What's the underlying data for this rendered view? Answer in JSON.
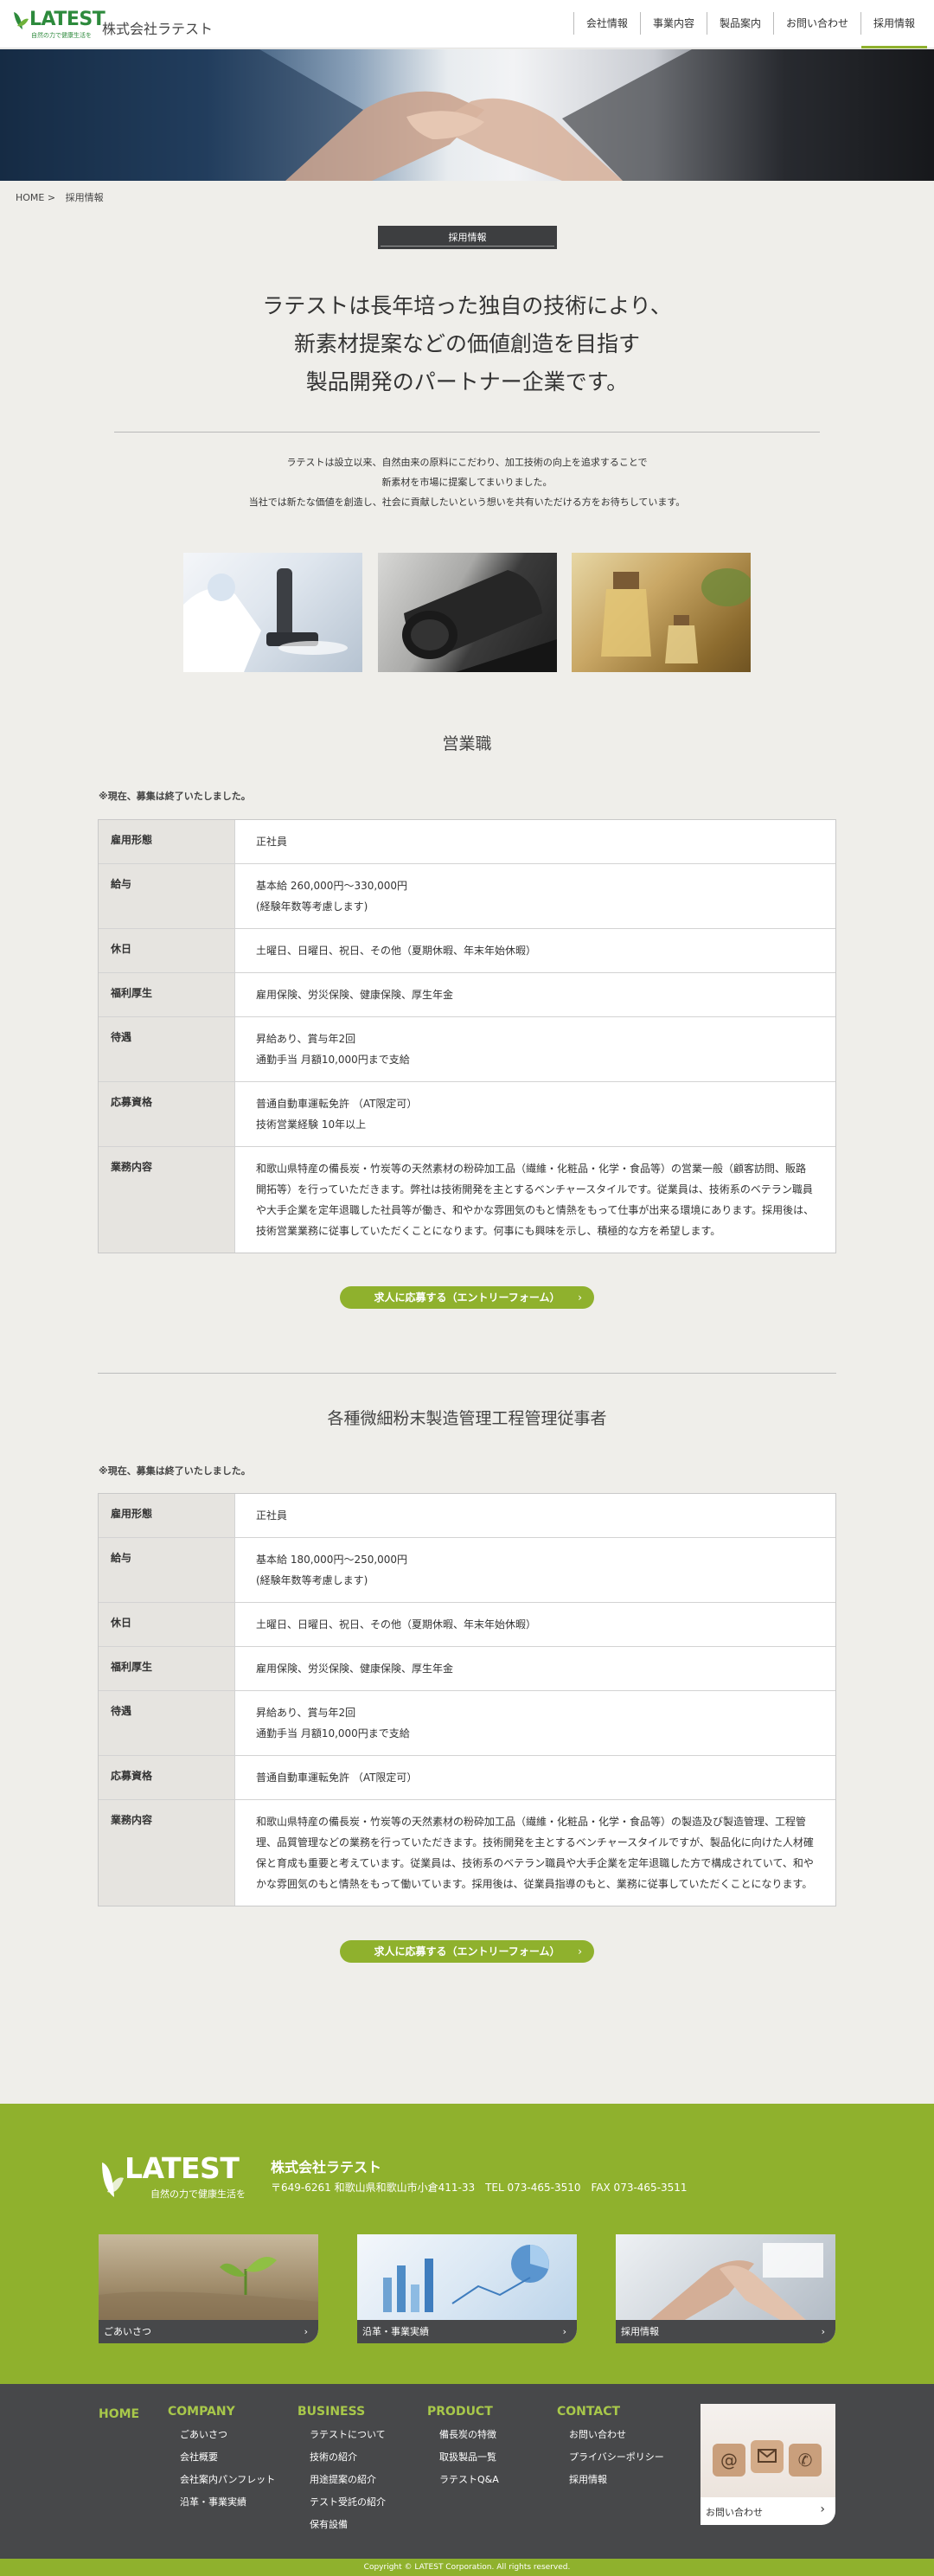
{
  "header": {
    "logo_word": "LATEST",
    "logo_tagline": "自然の力で健康生活を",
    "company_name": "株式会社ラテスト",
    "nav": [
      "会社情報",
      "事業内容",
      "製品案内",
      "お問い合わせ",
      "採用情報"
    ]
  },
  "breadcrumb": {
    "home": "HOME",
    "sep": ">",
    "current": "採用情報"
  },
  "page_title": "採用情報",
  "catch": [
    "ラテストは長年培った独自の技術により、",
    "新素材提案などの価値創造を目指す",
    "製品開発のパートナー企業です。"
  ],
  "intro": [
    "ラテストは設立以来、自然由来の原料にこだわり、加工技術の向上を追求することで",
    "新素材を市場に提案してまいりました。",
    "当社では新たな価値を創造し、社会に貢献したいという想いを共有いただける方をお待ちしています。"
  ],
  "jobs": [
    {
      "title": "営業職",
      "notice": "※現在、募集は終了いたしました。",
      "rows": [
        {
          "label": "雇用形態",
          "lines": [
            "正社員"
          ]
        },
        {
          "label": "給与",
          "lines": [
            "基本給 260,000円〜330,000円",
            "(経験年数等考慮します)"
          ]
        },
        {
          "label": "休日",
          "lines": [
            "土曜日、日曜日、祝日、その他（夏期休暇、年末年始休暇）"
          ]
        },
        {
          "label": "福利厚生",
          "lines": [
            "雇用保険、労災保険、健康保険、厚生年金"
          ]
        },
        {
          "label": "待遇",
          "lines": [
            "昇給あり、賞与年2回",
            "通勤手当 月額10,000円まで支給"
          ]
        },
        {
          "label": "応募資格",
          "lines": [
            "普通自動車運転免許 （AT限定可）",
            "技術営業経験 10年以上"
          ]
        },
        {
          "label": "業務内容",
          "lines": [
            "和歌山県特産の備長炭・竹炭等の天然素材の粉砕加工品（繊維・化粧品・化学・食品等）の営業一般（顧客訪問、販路開拓等）を行っていただきます。弊社は技術開発を主とするベンチャースタイルです。従業員は、技術系のベテラン職員や大手企業を定年退職した社員等が働き、和やかな雰囲気のもと情熱をもって仕事が出来る環境にあります。採用後は、技術営業業務に従事していただくことになります。何事にも興味を示し、積極的な方を希望します。"
          ]
        }
      ],
      "entry_label": "求人に応募する（エントリーフォーム）"
    },
    {
      "title": "各種微細粉末製造管理工程管理従事者",
      "notice": "※現在、募集は終了いたしました。",
      "rows": [
        {
          "label": "雇用形態",
          "lines": [
            "正社員"
          ]
        },
        {
          "label": "給与",
          "lines": [
            "基本給 180,000円〜250,000円",
            "(経験年数等考慮します)"
          ]
        },
        {
          "label": "休日",
          "lines": [
            "土曜日、日曜日、祝日、その他（夏期休暇、年末年始休暇）"
          ]
        },
        {
          "label": "福利厚生",
          "lines": [
            "雇用保険、労災保険、健康保険、厚生年金"
          ]
        },
        {
          "label": "待遇",
          "lines": [
            "昇給あり、賞与年2回",
            "通勤手当 月額10,000円まで支給"
          ]
        },
        {
          "label": "応募資格",
          "lines": [
            "普通自動車運転免許 （AT限定可）"
          ]
        },
        {
          "label": "業務内容",
          "lines": [
            "和歌山県特産の備長炭・竹炭等の天然素材の粉砕加工品（繊維・化粧品・化学・食品等）の製造及び製造管理、工程管理、品質管理などの業務を行っていただきます。技術開発を主とするベンチャースタイルですが、製品化に向けた人材確保と育成も重要と考えています。従業員は、技術系のベテラン職員や大手企業を定年退職した方で構成されていて、和やかな雰囲気のもと情熱をもって働いています。採用後は、従業員指導のもと、業務に従事していただくことになります。"
          ]
        }
      ],
      "entry_label": "求人に応募する（エントリーフォーム）"
    }
  ],
  "footer": {
    "logo_word": "LATEST",
    "logo_tagline": "自然の力で健康生活を",
    "company": "株式会社ラテスト",
    "address": "〒649-6261 和歌山県和歌山市小倉411-33　TEL 073-465-3510　FAX 073-465-3511",
    "cards": [
      "ごあいさつ",
      "沿革・事業実績",
      "採用情報"
    ],
    "columns": [
      {
        "head": "HOME",
        "items": []
      },
      {
        "head": "COMPANY",
        "items": [
          "ごあいさつ",
          "会社概要",
          "会社案内パンフレット",
          "沿革・事業実績"
        ]
      },
      {
        "head": "BUSINESS",
        "items": [
          "ラテストについて",
          "技術の紹介",
          "用途提案の紹介",
          "テスト受託の紹介",
          "保有設備"
        ]
      },
      {
        "head": "PRODUCT",
        "items": [
          "備長炭の特徴",
          "取扱製品一覧",
          "ラテストQ&A"
        ]
      },
      {
        "head": "CONTACT",
        "items": [
          "お問い合わせ",
          "プライバシーポリシー",
          "採用情報"
        ]
      }
    ],
    "contact_card": "お問い合わせ",
    "copyright": "Copyright © LATEST Corporation. All rights reserved."
  },
  "colors": {
    "accent": "#8fb12d",
    "dark": "#47484a",
    "background": "#efeeea"
  }
}
